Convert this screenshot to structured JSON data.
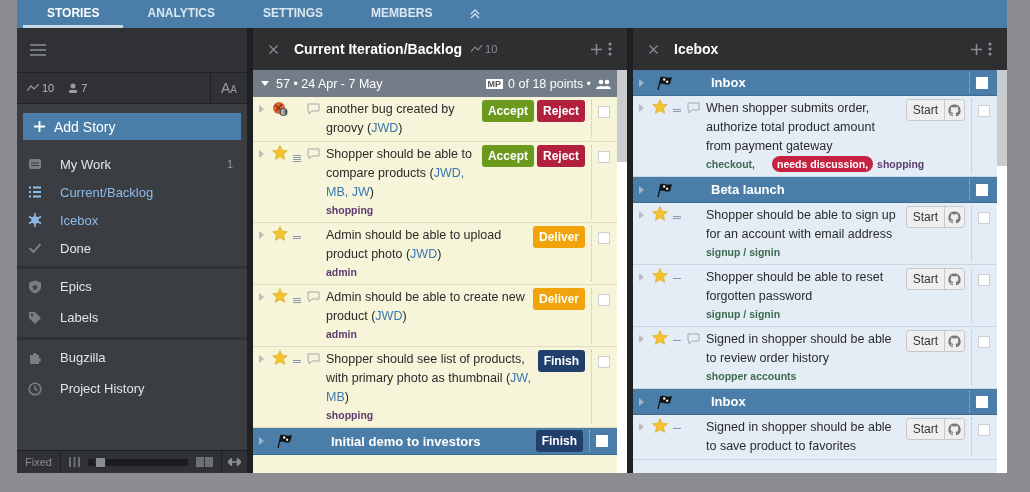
{
  "top_tabs": [
    {
      "label": "STORIES",
      "selected": true
    },
    {
      "label": "ANALYTICS",
      "selected": false
    },
    {
      "label": "SETTINGS",
      "selected": false
    },
    {
      "label": "MEMBERS",
      "selected": false
    }
  ],
  "sidebar": {
    "velocity": "10",
    "members": "7",
    "font_button": "A$_{A}$",
    "add_story": "Add Story",
    "groups": [
      [
        {
          "label": "My Work",
          "kind": "inbox",
          "active": false,
          "count": "1"
        },
        {
          "label": "Current/Backlog",
          "kind": "list",
          "active": true
        },
        {
          "label": "Icebox",
          "kind": "snowflake",
          "active": true
        },
        {
          "label": "Done",
          "kind": "check",
          "active": false
        }
      ],
      [
        {
          "label": "Epics",
          "kind": "shield",
          "active": false
        },
        {
          "label": "Labels",
          "kind": "tag",
          "active": false
        }
      ],
      [
        {
          "label": "Bugzilla",
          "kind": "puzzle",
          "active": false
        },
        {
          "label": "Project History",
          "kind": "clock",
          "active": false
        }
      ]
    ],
    "footer": {
      "mode": "Fixed",
      "level": 0.12
    }
  },
  "panels": [
    {
      "title": "Current Iteration/Backlog",
      "velocity": "10",
      "kind": "current",
      "iteration": {
        "title": "57 • 24 Apr - 7 May",
        "badge": "MP",
        "points": "0 of 18 points •"
      },
      "rows": [
        {
          "kind": "story",
          "type": {
            "kind": "bug"
          },
          "estimate": {
            "kind": "none"
          },
          "comments": true,
          "segments": [
            {
              "text": "another bug created by groovy (",
              "kind": "plain"
            },
            {
              "text": "JWD",
              "kind": "owner"
            },
            {
              "text": ")",
              "kind": "plain"
            }
          ],
          "labels": [],
          "actions": [
            {
              "label": "Accept",
              "kind": "accept"
            },
            {
              "label": "Reject",
              "kind": "reject"
            }
          ],
          "checked": false
        },
        {
          "kind": "story",
          "type": {
            "kind": "feature"
          },
          "estimate": {
            "kind": "four"
          },
          "comments": true,
          "segments": [
            {
              "text": "Shopper should be able to compare products (",
              "kind": "plain"
            },
            {
              "text": "JWD, MB, JW",
              "kind": "owner"
            },
            {
              "text": ")",
              "kind": "plain"
            }
          ],
          "labels": [
            {
              "text": "shopping",
              "color": "#5d3c6e",
              "flag": false
            }
          ],
          "actions": [
            {
              "label": "Accept",
              "kind": "accept"
            },
            {
              "label": "Reject",
              "kind": "reject"
            }
          ],
          "checked": false
        },
        {
          "kind": "story",
          "type": {
            "kind": "feature"
          },
          "estimate": {
            "kind": "two"
          },
          "comments": false,
          "segments": [
            {
              "text": "Admin should be able to upload product photo (",
              "kind": "plain"
            },
            {
              "text": "JWD",
              "kind": "owner"
            },
            {
              "text": ")",
              "kind": "plain"
            }
          ],
          "labels": [
            {
              "text": "admin",
              "color": "#5d3c6e",
              "flag": false
            }
          ],
          "actions": [
            {
              "label": "Deliver",
              "kind": "deliver"
            }
          ],
          "checked": false
        },
        {
          "kind": "story",
          "type": {
            "kind": "feature"
          },
          "estimate": {
            "kind": "three"
          },
          "comments": true,
          "segments": [
            {
              "text": "Admin should be able to create new product (",
              "kind": "plain"
            },
            {
              "text": "JWD",
              "kind": "owner"
            },
            {
              "text": ")",
              "kind": "plain"
            }
          ],
          "labels": [
            {
              "text": "admin",
              "color": "#5d3c6e",
              "flag": false
            }
          ],
          "actions": [
            {
              "label": "Deliver",
              "kind": "deliver"
            }
          ],
          "checked": false
        },
        {
          "kind": "story",
          "type": {
            "kind": "feature"
          },
          "estimate": {
            "kind": "two"
          },
          "comments": true,
          "segments": [
            {
              "text": "Shopper should see list of products, with primary photo as thumbnail (",
              "kind": "plain"
            },
            {
              "text": "JW, MB",
              "kind": "owner"
            },
            {
              "text": ")",
              "kind": "plain"
            }
          ],
          "labels": [
            {
              "text": "shopping",
              "color": "#5d3c6e",
              "flag": false
            }
          ],
          "actions": [
            {
              "label": "Finish",
              "kind": "finish"
            }
          ],
          "checked": false
        },
        {
          "kind": "marker",
          "title": "Initial demo to investors",
          "actions": [
            {
              "label": "Finish",
              "kind": "finish"
            }
          ],
          "checked": false
        }
      ]
    },
    {
      "title": "Icebox",
      "kind": "icebox",
      "rows": [
        {
          "kind": "marker",
          "title": "Inbox",
          "actions": [],
          "checked": false
        },
        {
          "kind": "story",
          "type": {
            "kind": "feature"
          },
          "estimate": {
            "kind": "two"
          },
          "comments": true,
          "segments": [
            {
              "text": "When shopper submits order, authorize total product amount from payment gateway",
              "kind": "plain"
            }
          ],
          "labels": [
            {
              "text": "checkout,",
              "color": "#3d6b4f",
              "flag": false
            },
            {
              "text": "needs discussion,",
              "color": "#c4223f",
              "flag": true
            },
            {
              "text": "shopping",
              "color": "#5d3c6e",
              "flag": false
            }
          ],
          "actions": [
            {
              "label": "Start",
              "kind": "start"
            }
          ],
          "checked": false
        },
        {
          "kind": "marker",
          "title": "Beta launch",
          "actions": [],
          "checked": false
        },
        {
          "kind": "story",
          "type": {
            "kind": "feature"
          },
          "estimate": {
            "kind": "two"
          },
          "comments": false,
          "segments": [
            {
              "text": "Shopper should be able to sign up for an account with email address",
              "kind": "plain"
            }
          ],
          "labels": [
            {
              "text": "signup / signin",
              "color": "#3d6b4f",
              "flag": false
            }
          ],
          "actions": [
            {
              "label": "Start",
              "kind": "start"
            }
          ],
          "checked": false
        },
        {
          "kind": "story",
          "type": {
            "kind": "feature"
          },
          "estimate": {
            "kind": "one"
          },
          "comments": false,
          "segments": [
            {
              "text": "Shopper should be able to reset forgotten password",
              "kind": "plain"
            }
          ],
          "labels": [
            {
              "text": "signup / signin",
              "color": "#3d6b4f",
              "flag": false
            }
          ],
          "actions": [
            {
              "label": "Start",
              "kind": "start"
            }
          ],
          "checked": false
        },
        {
          "kind": "story",
          "type": {
            "kind": "feature"
          },
          "estimate": {
            "kind": "one"
          },
          "comments": true,
          "segments": [
            {
              "text": "Signed in shopper should be able to review order history",
              "kind": "plain"
            }
          ],
          "labels": [
            {
              "text": "shopper accounts",
              "color": "#3d6b4f",
              "flag": false
            }
          ],
          "actions": [
            {
              "label": "Start",
              "kind": "start"
            }
          ],
          "checked": false
        },
        {
          "kind": "marker",
          "title": "Inbox",
          "actions": [],
          "checked": false
        },
        {
          "kind": "story",
          "type": {
            "kind": "feature"
          },
          "estimate": {
            "kind": "one"
          },
          "comments": false,
          "segments": [
            {
              "text": "Signed in shopper should be able to save product to favorites",
              "kind": "plain"
            }
          ],
          "labels": [],
          "actions": [
            {
              "label": "Start",
              "kind": "start"
            }
          ],
          "checked": false
        }
      ]
    }
  ]
}
